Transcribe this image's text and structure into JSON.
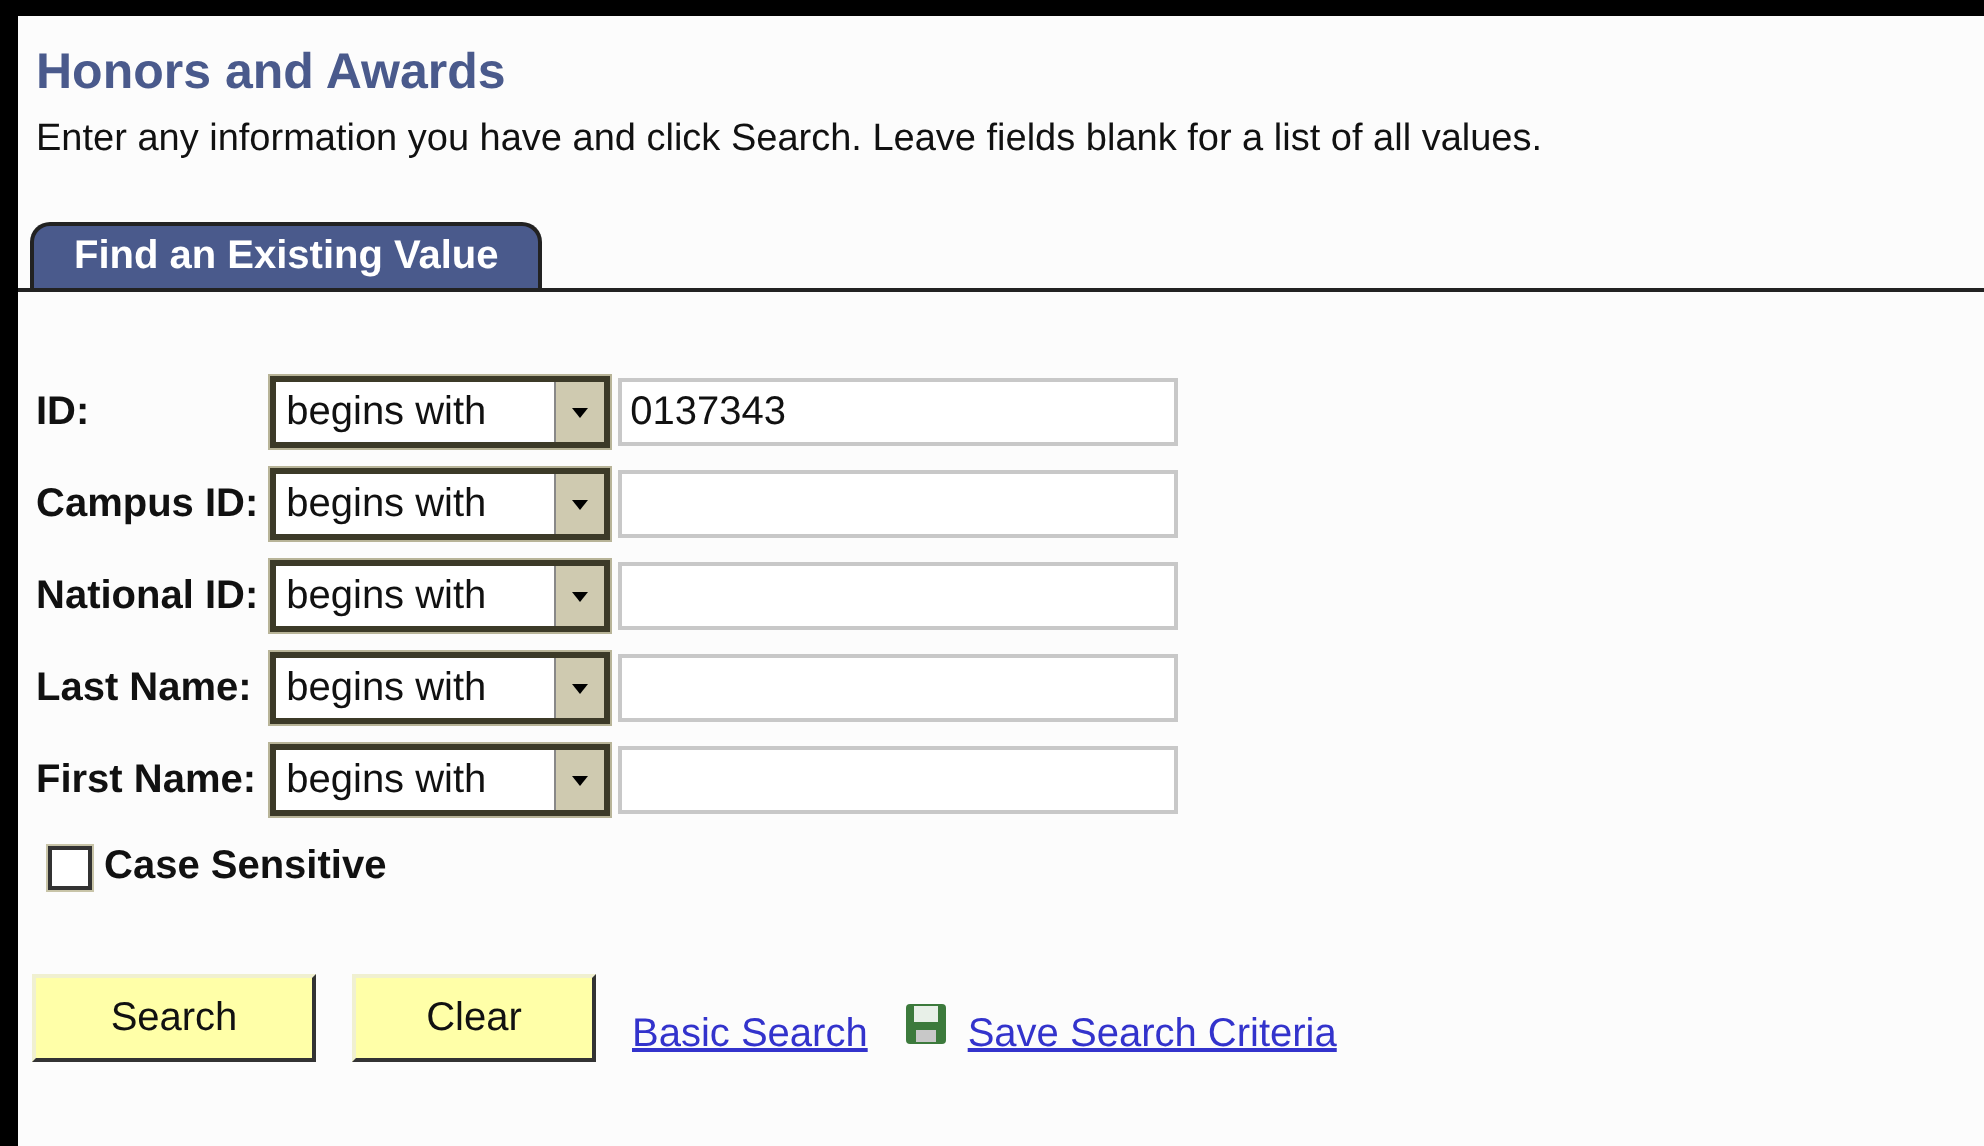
{
  "page": {
    "title": "Honors and Awards",
    "instructions": "Enter any information you have and click Search. Leave fields blank for a list of all values."
  },
  "tabs": [
    {
      "label": "Find an Existing Value",
      "selected": true
    }
  ],
  "fields": [
    {
      "label": "ID:",
      "operator": "begins with",
      "value": "0137343"
    },
    {
      "label": "Campus ID:",
      "operator": "begins with"
    },
    {
      "label": "National ID:",
      "operator": "begins with"
    },
    {
      "label": "Last Name:",
      "operator": "begins with"
    },
    {
      "label": "First Name:",
      "operator": "begins with"
    }
  ],
  "case_sensitive": {
    "label": "Case Sensitive",
    "checked": false
  },
  "buttons": [
    "Search",
    "Clear"
  ],
  "links": [
    {
      "label": "Basic Search",
      "kind": "plain"
    },
    {
      "label": "Save Search Criteria",
      "kind": "save"
    }
  ]
}
